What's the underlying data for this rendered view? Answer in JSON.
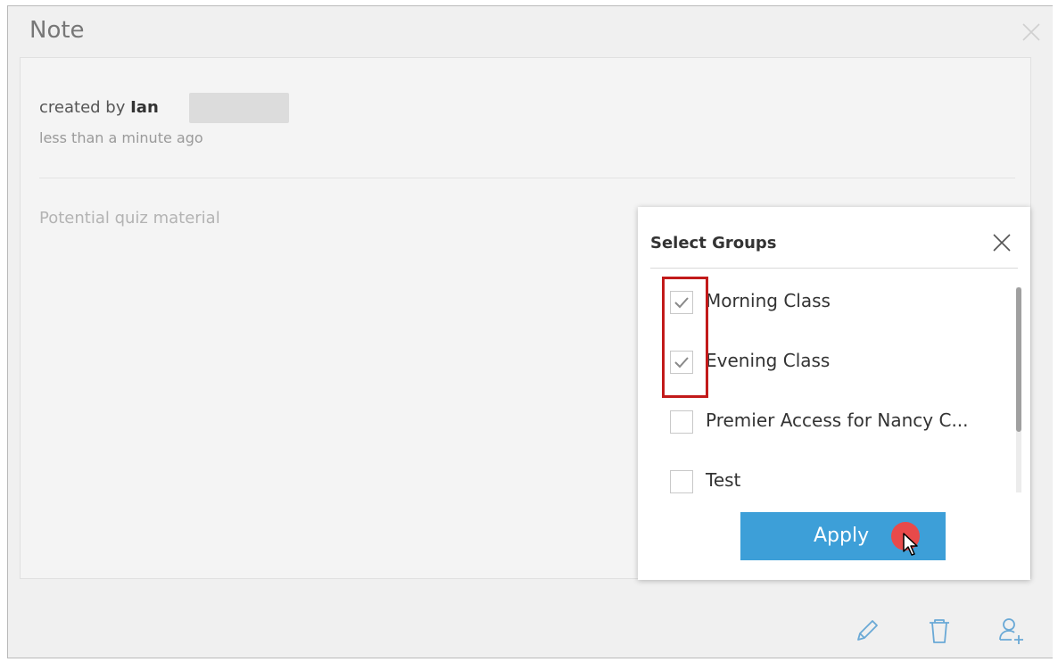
{
  "dialog": {
    "title": "Note"
  },
  "note": {
    "created_prefix": "created by",
    "author": "Ian",
    "time": "less than a minute ago",
    "body": "Potential quiz material"
  },
  "popup": {
    "title": "Select Groups",
    "groups": [
      {
        "label": "Morning Class",
        "checked": true
      },
      {
        "label": "Evening Class",
        "checked": true
      },
      {
        "label": "Premier Access for Nancy C...",
        "checked": false
      },
      {
        "label": "Test",
        "checked": false
      }
    ],
    "apply_label": "Apply"
  },
  "icons": {
    "footer": [
      "pencil-icon",
      "trash-icon",
      "user-add-icon"
    ],
    "close": "close-icon",
    "check": "checkmark-icon",
    "cursor": "mouse-pointer-icon"
  },
  "colors": {
    "accent": "#3d9fd8",
    "highlight": "#c21a1a",
    "click_indicator": "#e84a4a",
    "icon_blue": "#6aa9d6"
  }
}
